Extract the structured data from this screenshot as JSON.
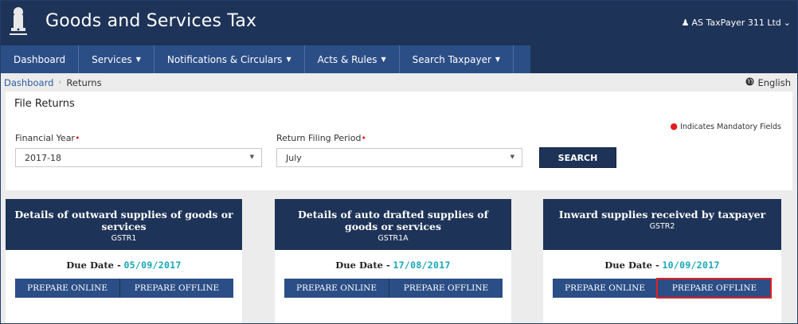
{
  "header": {
    "site_title": "Goods and Services Tax",
    "user_menu": "AS TaxPayer 311 Ltd"
  },
  "nav": {
    "items": [
      {
        "label": "Dashboard",
        "has_caret": false
      },
      {
        "label": "Services",
        "has_caret": true
      },
      {
        "label": "Notifications & Circulars",
        "has_caret": true
      },
      {
        "label": "Acts & Rules",
        "has_caret": true
      },
      {
        "label": "Search Taxpayer",
        "has_caret": true
      }
    ]
  },
  "breadcrumb": {
    "home": "Dashboard",
    "current": "Returns",
    "language": "English"
  },
  "file_returns": {
    "title": "File Returns",
    "mandatory_note": "Indicates Mandatory Fields",
    "financial_year": {
      "label": "Financial Year",
      "value": "2017-18"
    },
    "return_period": {
      "label": "Return Filing Period",
      "value": "July"
    },
    "search_label": "SEARCH"
  },
  "cards": [
    {
      "title": "Details of outward supplies of goods or services",
      "code": "GSTR1",
      "due_label": "Due Date -",
      "due_date": "05/09/2017",
      "online_label": "PREPARE ONLINE",
      "offline_label": "PREPARE OFFLINE",
      "offline_highlighted": false
    },
    {
      "title": "Details of auto drafted supplies of goods or services",
      "code": "GSTR1A",
      "due_label": "Due Date -",
      "due_date": "17/08/2017",
      "online_label": "PREPARE ONLINE",
      "offline_label": "PREPARE OFFLINE",
      "offline_highlighted": false
    },
    {
      "title": "Inward supplies received by taxpayer",
      "code": "GSTR2",
      "due_label": "Due Date -",
      "due_date": "10/09/2017",
      "online_label": "PREPARE ONLINE",
      "offline_label": "PREPARE OFFLINE",
      "offline_highlighted": true
    }
  ],
  "colors": {
    "header_bg": "#1e3358",
    "nav_bg": "#2c4e86",
    "due_date": "#1aa6b7",
    "required": "#e11d1d",
    "highlight": "#e02020"
  },
  "icons": {
    "emblem": "national-emblem-icon",
    "user": "user-icon",
    "dropdown": "chevron-down-icon",
    "language": "globe-icon"
  }
}
